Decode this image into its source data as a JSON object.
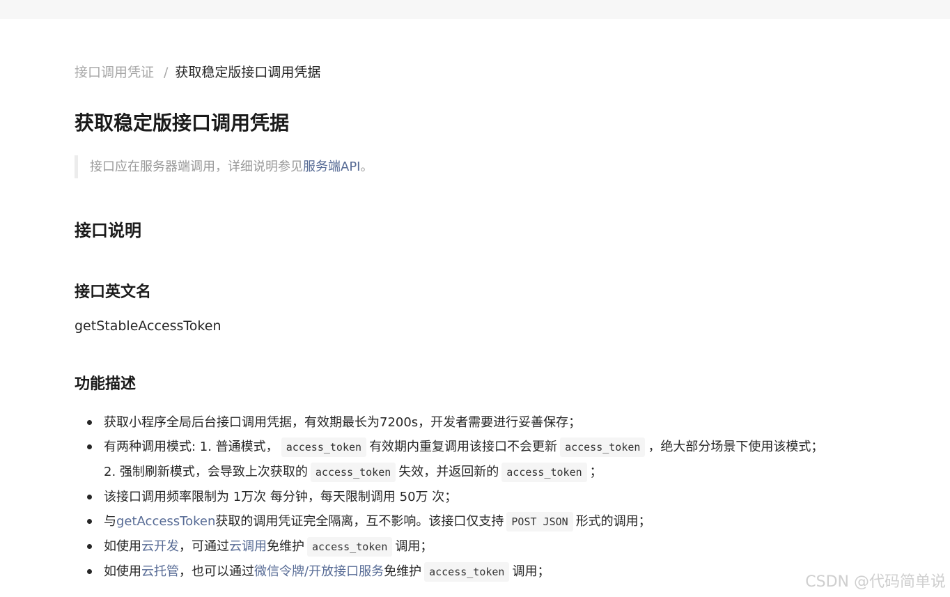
{
  "breadcrumb": {
    "parent": "接口调用凭证",
    "separator": "/",
    "current": "获取稳定版接口调用凭据"
  },
  "page_title": "获取稳定版接口调用凭据",
  "note": {
    "text_before": "接口应在服务器端调用，详细说明参见",
    "link": "服务端API",
    "text_after": "。"
  },
  "section_interface": "接口说明",
  "section_english_name": "接口英文名",
  "api_name": "getStableAccessToken",
  "section_function": "功能描述",
  "bullets": {
    "b1": "获取小程序全局后台接口调用凭据，有效期最长为7200s，开发者需要进行妥善保存；",
    "b2_t1": "有两种调用模式: 1. 普通模式，",
    "b2_c1": "access_token",
    "b2_t2": "有效期内重复调用该接口不会更新",
    "b2_c2": "access_token",
    "b2_t3": "，绝大部分场景下使用该模式；",
    "b2_l2_t1": "2. 强制刷新模式，会导致上次获取的",
    "b2_l2_c1": "access_token",
    "b2_l2_t2": "失效，并返回新的",
    "b2_l2_c2": "access_token",
    "b2_l2_t3": "；",
    "b3": "该接口调用频率限制为 1万次 每分钟，每天限制调用 50万 次；",
    "b4_t1": "与",
    "b4_link": "getAccessToken",
    "b4_t2": "获取的调用凭证完全隔离，互不影响。该接口仅支持",
    "b4_code": "POST JSON",
    "b4_t3": "形式的调用；",
    "b5_t1": "如使用",
    "b5_link1": "云开发",
    "b5_t2": "，可通过",
    "b5_link2": "云调用",
    "b5_t3": "免维护",
    "b5_code": "access_token",
    "b5_t4": "调用；",
    "b6_t1": "如使用",
    "b6_link1": "云托管",
    "b6_t2": "，也可以通过",
    "b6_link2": "微信令牌/开放接口服务",
    "b6_t3": "免维护",
    "b6_code": "access_token",
    "b6_t4": "调用；"
  },
  "watermark": "CSDN @代码简单说",
  "colors": {
    "link": "#576b95",
    "muted": "#a8a8a8",
    "text": "#262626"
  }
}
